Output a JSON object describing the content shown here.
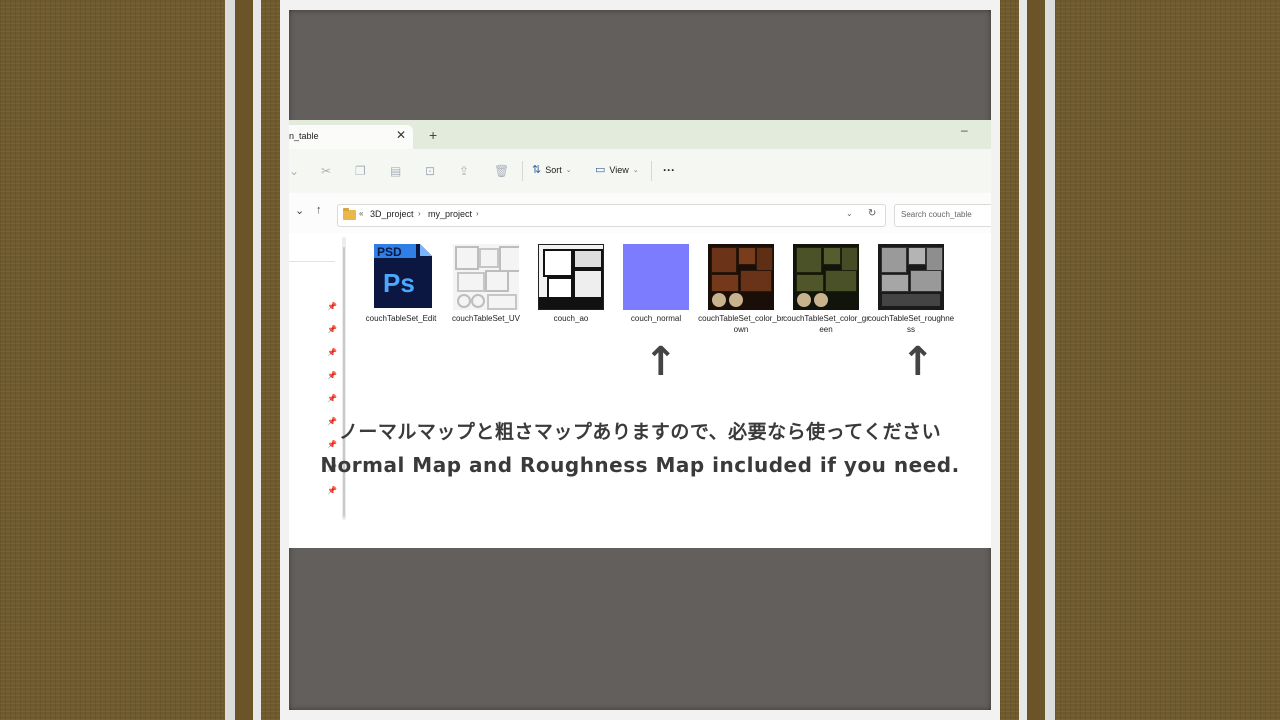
{
  "tab": {
    "title": "n_table",
    "close": "✕",
    "new": "+"
  },
  "window_controls": {
    "minimize": "–"
  },
  "toolbar": {
    "sort_label": "Sort",
    "view_label": "View",
    "more_label": "···"
  },
  "address_bar": {
    "prefix": "«",
    "crumbs": [
      "3D_project",
      "my_project"
    ],
    "separator": "›"
  },
  "search": {
    "placeholder": "Search couch_table"
  },
  "files": [
    {
      "name": "couchTableSet_Edit",
      "kind": "psd",
      "badge_top": "PSD",
      "badge_main": "Ps"
    },
    {
      "name": "couchTableSet_UV",
      "kind": "uv"
    },
    {
      "name": "couch_ao",
      "kind": "ao"
    },
    {
      "name": "couch_normal",
      "kind": "normal"
    },
    {
      "name": "couchTableSet_color_brown",
      "kind": "brown"
    },
    {
      "name": "couchTableSet_color_green",
      "kind": "green"
    },
    {
      "name": "couchTableSet_roughness",
      "kind": "rough"
    }
  ],
  "arrows": [
    "↑",
    "↑"
  ],
  "caption": {
    "japanese": "ノーマルマップと粗さマップありますので、必要なら使ってください",
    "english": "Normal Map and Roughness Map included if you need."
  },
  "colors": {
    "background": "#6e5a2c",
    "stage": "#625f5c",
    "normal_map": "#7c7cff",
    "tabbar": "#e3ecdc"
  }
}
